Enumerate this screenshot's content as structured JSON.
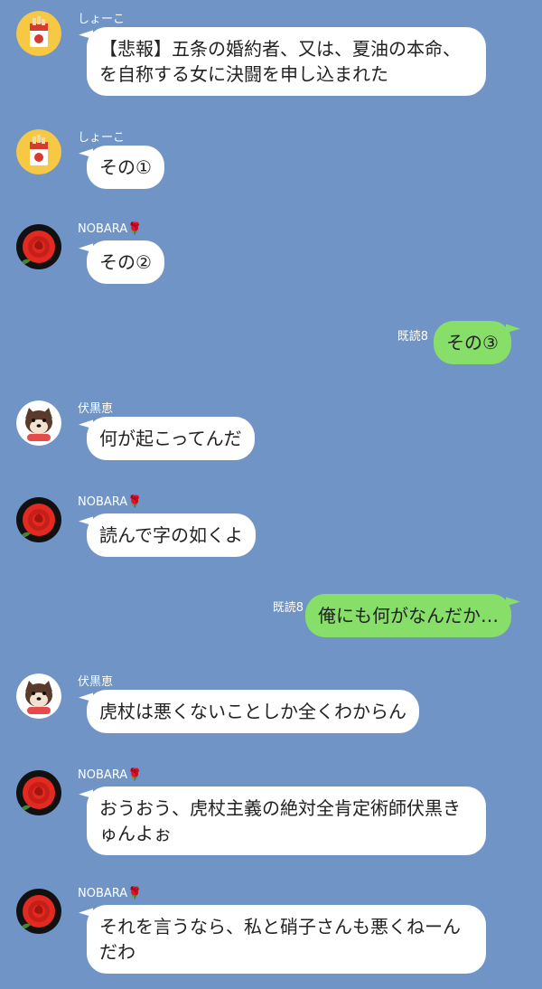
{
  "colors": {
    "background": "#6f94c5",
    "incoming_bubble": "#ffffff",
    "outgoing_bubble": "#87df6a"
  },
  "messages": [
    {
      "sender": "しょーこ",
      "avatar": "cigarette-pack-icon",
      "text": "【悲報】五条の婚約者、又は、夏油の本命、\nを自称する女に決闘を申し込まれた"
    },
    {
      "sender": "しょーこ",
      "avatar": "cigarette-pack-icon",
      "text": "その①"
    },
    {
      "sender": "NOBARA🌹",
      "avatar": "red-rose-icon",
      "text": "その②"
    },
    {
      "read": "既読8",
      "text": "その③"
    },
    {
      "sender": "伏黒恵",
      "avatar": "shiba-dog-icon",
      "text": "何が起こってんだ"
    },
    {
      "sender": "NOBARA🌹",
      "avatar": "red-rose-icon",
      "text": "読んで字の如くよ"
    },
    {
      "read": "既読8",
      "text": "俺にも何がなんだか…"
    },
    {
      "sender": "伏黒恵",
      "avatar": "shiba-dog-icon",
      "text": "虎杖は悪くないことしか全くわからん"
    },
    {
      "sender": "NOBARA🌹",
      "avatar": "red-rose-icon",
      "text": "おうおう、虎杖主義の絶対全肯定術師伏黒き\nゅんよぉ"
    },
    {
      "sender": "NOBARA🌹",
      "avatar": "red-rose-icon",
      "text": "それを言うなら、私と硝子さんも悪くねーん\nだわ"
    }
  ]
}
